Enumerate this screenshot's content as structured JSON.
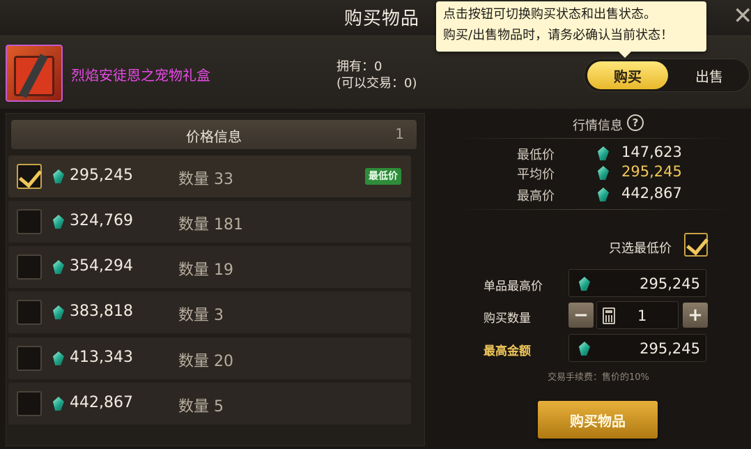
{
  "window": {
    "title": "购买物品",
    "close_icon": "close-icon"
  },
  "tooltip": {
    "line1": "点击按钮可切换购买状态和出售状态。",
    "line2": "购买/出售物品时，请务必确认当前状态！"
  },
  "item": {
    "name": "烈焰安徒恩之宠物礼盒",
    "name_color": "#e84ae8",
    "owned": "拥有：0",
    "tradable": "(可以交易：0)"
  },
  "mode_toggle": {
    "buy_label": "购买",
    "sell_label": "出售",
    "selected": "buy"
  },
  "price_list": {
    "header": "价格信息",
    "page": "1",
    "rows": [
      {
        "checked": true,
        "price": "295,245",
        "qty": "数量 33",
        "badge": "最低价"
      },
      {
        "checked": false,
        "price": "324,769",
        "qty": "数量 181",
        "badge": ""
      },
      {
        "checked": false,
        "price": "354,294",
        "qty": "数量 19",
        "badge": ""
      },
      {
        "checked": false,
        "price": "383,818",
        "qty": "数量 3",
        "badge": ""
      },
      {
        "checked": false,
        "price": "413,343",
        "qty": "数量 20",
        "badge": ""
      },
      {
        "checked": false,
        "price": "442,867",
        "qty": "数量 5",
        "badge": ""
      }
    ]
  },
  "market": {
    "title": "行情信息",
    "help": "?",
    "min_label": "最低价",
    "min_value": "147,623",
    "avg_label": "平均价",
    "avg_value": "295,245",
    "max_label": "最高价",
    "max_value": "442,867"
  },
  "order": {
    "only_lowest_label": "只选最低价",
    "only_lowest_checked": true,
    "unit_max_label": "单品最高价",
    "unit_max_value": "295,245",
    "qty_label": "购买数量",
    "qty_value": "1",
    "minus": "−",
    "plus": "+",
    "total_label": "最高金额",
    "total_value": "295,245",
    "fee_note": "交易手续费：售价的10%",
    "buy_button": "购买物品"
  },
  "colors": {
    "accent_gold": "#f0c75a",
    "gem": "#1ea58a",
    "badge_green": "#2e8c3a"
  }
}
